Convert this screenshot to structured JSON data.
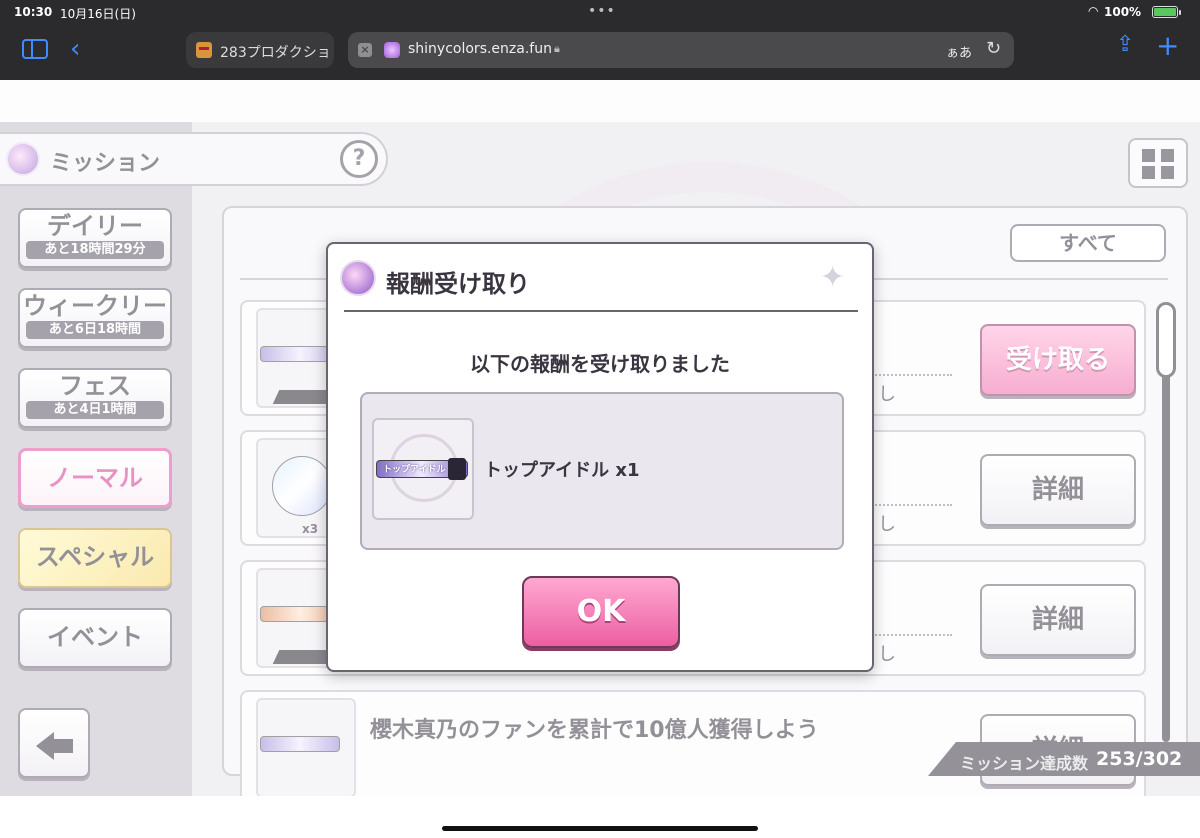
{
  "status_bar": {
    "time": "10:30",
    "date": "10月16日(日)",
    "battery": "100%"
  },
  "browser": {
    "inactive_tab_title": "283プロダクショ",
    "url": "shinycolors.enza.fun",
    "reader_label": "ぁあ"
  },
  "game": {
    "title": "ミッション",
    "help": "?",
    "sidebar": [
      {
        "label": "デイリー",
        "sub": "あと18時間29分"
      },
      {
        "label": "ウィークリー",
        "sub": "あと6日18時間"
      },
      {
        "label": "フェス",
        "sub": "あと4日1時間"
      },
      {
        "label": "ノーマル"
      },
      {
        "label": "スペシャル"
      },
      {
        "label": "イベント"
      }
    ],
    "all_button": "すべて",
    "rows": [
      {
        "tail": "し",
        "button": "受け取る"
      },
      {
        "tail": "し",
        "button": "詳細",
        "thumb_count": "x3"
      },
      {
        "tail": "し",
        "button": "詳細"
      },
      {
        "text": "櫻木真乃のファンを累計で10億人獲得しよう",
        "button": "詳細"
      }
    ],
    "progress_label": "ミッション達成数",
    "progress_value": "253/302"
  },
  "modal": {
    "title": "報酬受け取り",
    "message": "以下の報酬を受け取りました",
    "reward_plate": "トップアイドル",
    "reward_text": "トップアイドル x1",
    "ok_label": "OK"
  }
}
